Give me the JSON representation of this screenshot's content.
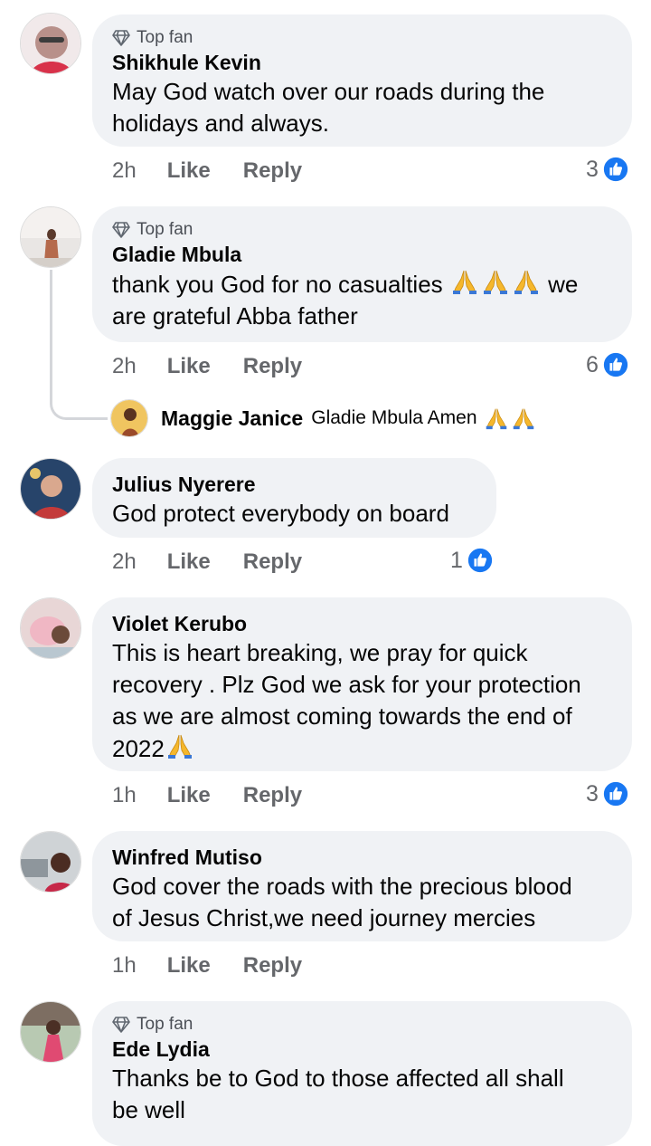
{
  "badge_label": "Top fan",
  "action_like": "Like",
  "action_reply": "Reply",
  "comments": [
    {
      "author": "Shikhule Kevin",
      "top_fan": true,
      "text_lines": [
        "May God watch over our roads during the",
        "holidays and always."
      ],
      "time": "2h",
      "like_count": "3"
    },
    {
      "author": "Gladie Mbula",
      "top_fan": true,
      "text_lines": [
        "thank you God for no casualties",
        "we",
        "are grateful Abba father"
      ],
      "time": "2h",
      "like_count": "6",
      "reply": {
        "author": "Maggie Janice",
        "text": "Gladie Mbula Amen"
      }
    },
    {
      "author": "Julius Nyerere",
      "top_fan": false,
      "text_lines": [
        "God protect everybody on board"
      ],
      "time": "2h",
      "like_count": "1"
    },
    {
      "author": "Violet Kerubo",
      "top_fan": false,
      "text_lines": [
        "This is heart breaking, we pray for quick",
        "recovery . Plz God we ask for your protection",
        "as we are almost coming towards the end of",
        "2022"
      ],
      "time": "1h",
      "like_count": "3"
    },
    {
      "author": "Winfred Mutiso",
      "top_fan": false,
      "text_lines": [
        "God cover the roads with the precious blood",
        "of Jesus Christ,we need journey mercies"
      ],
      "time": "1h",
      "like_count": ""
    },
    {
      "author": "Ede Lydia",
      "top_fan": true,
      "text_lines": [
        "Thanks be to God to those affected all shall",
        "be well"
      ],
      "time": "",
      "like_count": ""
    }
  ],
  "colors": {
    "bubble": "#f0f2f5",
    "meta_text": "#65676b",
    "like_blue": "#1877f2"
  },
  "icons": {
    "badge": "diamond-icon",
    "like": "thumbs-up-icon",
    "emoji": "folded-hands-icon"
  }
}
